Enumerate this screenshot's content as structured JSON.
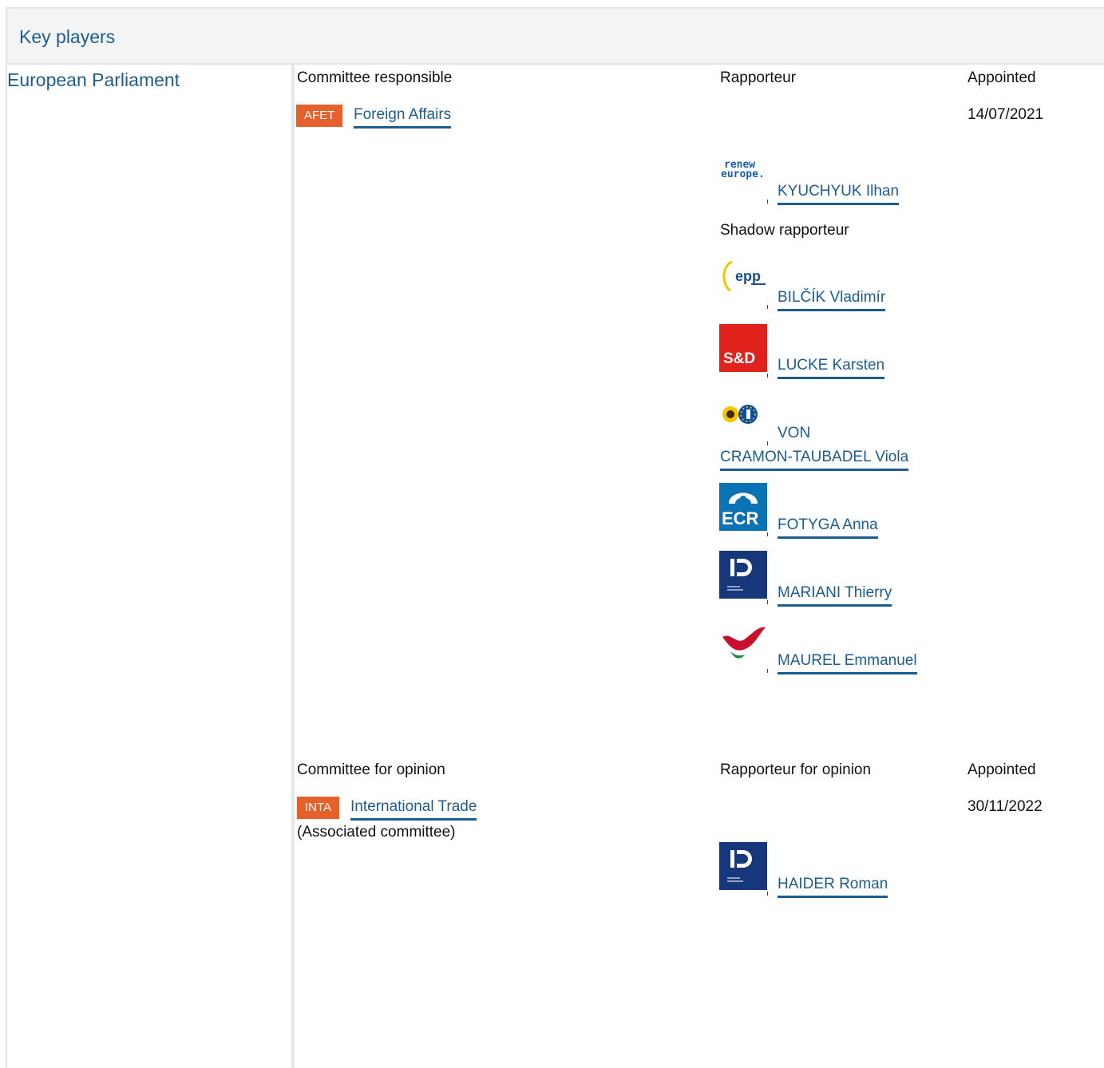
{
  "header": {
    "title": "Key players"
  },
  "institution": "European Parliament",
  "responsible": {
    "col_committee": "Committee responsible",
    "col_rapporteur": "Rapporteur",
    "col_appointed": "Appointed",
    "committee_code": "AFET",
    "committee_name": "Foreign Affairs",
    "appointed_date": "14/07/2021",
    "rapporteur": {
      "group_icon": "renew-europe-logo",
      "logo_text_1": "renew",
      "logo_text_2": "europe.",
      "name": "KYUCHYUK Ilhan"
    },
    "shadow_label": "Shadow rapporteur",
    "shadows": [
      {
        "group_icon": "epp-logo",
        "logo_text": "epp",
        "name": "BILČÍK Vladimír"
      },
      {
        "group_icon": "sd-logo",
        "logo_text": "S&D",
        "name": "LUCKE Karsten"
      },
      {
        "group_icon": "greens-efa-logo",
        "name_line1": "VON",
        "name_line2": "CRAMON-TAUBADEL Viola"
      },
      {
        "group_icon": "ecr-logo",
        "logo_text": "ECR",
        "name": "FOTYGA Anna"
      },
      {
        "group_icon": "id-logo",
        "name": "MARIANI Thierry"
      },
      {
        "group_icon": "left-logo",
        "name": "MAUREL Emmanuel"
      }
    ]
  },
  "opinion": {
    "col_committee": "Committee for opinion",
    "col_rapporteur": "Rapporteur for opinion",
    "col_appointed": "Appointed",
    "committee_code": "INTA",
    "committee_name": "International Trade",
    "committee_note": "(Associated committee)",
    "appointed_date": "30/11/2022",
    "rapporteur": {
      "group_icon": "id-logo",
      "name": "HAIDER Roman"
    }
  },
  "colors": {
    "link": "#1d5c8f",
    "badge": "#e5602b",
    "header_bg": "#f4f4f4"
  }
}
